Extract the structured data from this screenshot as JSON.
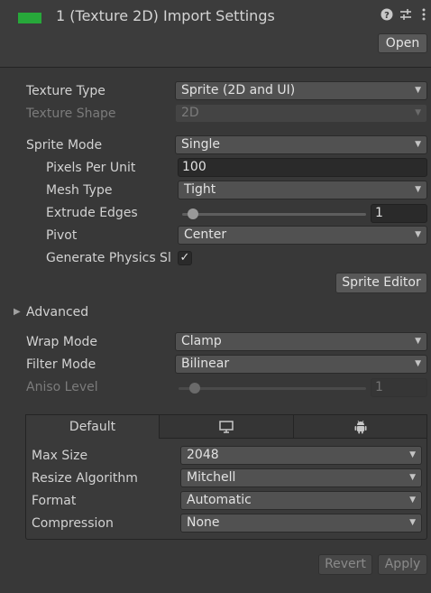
{
  "header": {
    "title": "1 (Texture 2D) Import Settings",
    "icon_color": "#27a83a",
    "open_button": "Open",
    "icons": [
      "help-icon",
      "presets-icon",
      "menu-icon"
    ]
  },
  "texture": {
    "type_label": "Texture Type",
    "type_value": "Sprite (2D and UI)",
    "shape_label": "Texture Shape",
    "shape_value": "2D"
  },
  "sprite": {
    "mode_label": "Sprite Mode",
    "mode_value": "Single",
    "ppu_label": "Pixels Per Unit",
    "ppu_value": "100",
    "mesh_label": "Mesh Type",
    "mesh_value": "Tight",
    "extrude_label": "Extrude Edges",
    "extrude_value": "1",
    "extrude_fraction": 0.03,
    "pivot_label": "Pivot",
    "pivot_value": "Center",
    "physics_label": "Generate Physics Sl",
    "physics_checked": true,
    "editor_button": "Sprite Editor"
  },
  "advanced": {
    "label": "Advanced"
  },
  "wrap": {
    "wrap_label": "Wrap Mode",
    "wrap_value": "Clamp",
    "filter_label": "Filter Mode",
    "filter_value": "Bilinear",
    "aniso_label": "Aniso Level",
    "aniso_value": "1",
    "aniso_fraction": 0.06
  },
  "platform": {
    "tabs": [
      {
        "label": "Default",
        "active": true
      },
      {
        "icon": "monitor-icon",
        "active": false
      },
      {
        "icon": "android-icon",
        "active": false
      }
    ],
    "max_size_label": "Max Size",
    "max_size_value": "2048",
    "resize_label": "Resize Algorithm",
    "resize_value": "Mitchell",
    "format_label": "Format",
    "format_value": "Automatic",
    "compression_label": "Compression",
    "compression_value": "None"
  },
  "footer": {
    "revert": "Revert",
    "apply": "Apply"
  }
}
